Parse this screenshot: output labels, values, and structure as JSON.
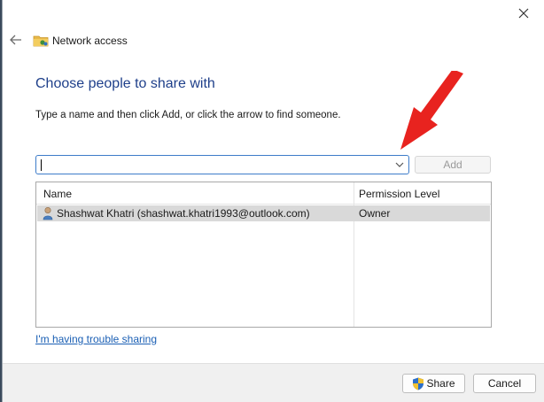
{
  "window": {
    "title": "Network access",
    "icons": {
      "close": "close-icon",
      "back": "back-arrow-icon",
      "title": "network-folder-icon"
    }
  },
  "main": {
    "heading": "Choose people to share with",
    "instruction": "Type a name and then click Add, or click the arrow to find someone.",
    "name_input": {
      "value": "",
      "placeholder": ""
    },
    "add_label": "Add"
  },
  "table": {
    "columns": [
      "Name",
      "Permission Level"
    ],
    "rows": [
      {
        "name": "Shashwat Khatri (shashwat.khatri1993@outlook.com)",
        "permission": "Owner",
        "icon": "user-icon"
      }
    ]
  },
  "trouble_link": "I'm having trouble sharing",
  "footer": {
    "share_label": "Share",
    "cancel_label": "Cancel",
    "share_icon": "uac-shield-icon"
  },
  "colors": {
    "heading": "#1e3f8a",
    "link": "#1a5fb4",
    "input_border": "#3d7cc9",
    "selected_row": "#d9d9d9",
    "annotation_arrow": "#e8231f"
  }
}
